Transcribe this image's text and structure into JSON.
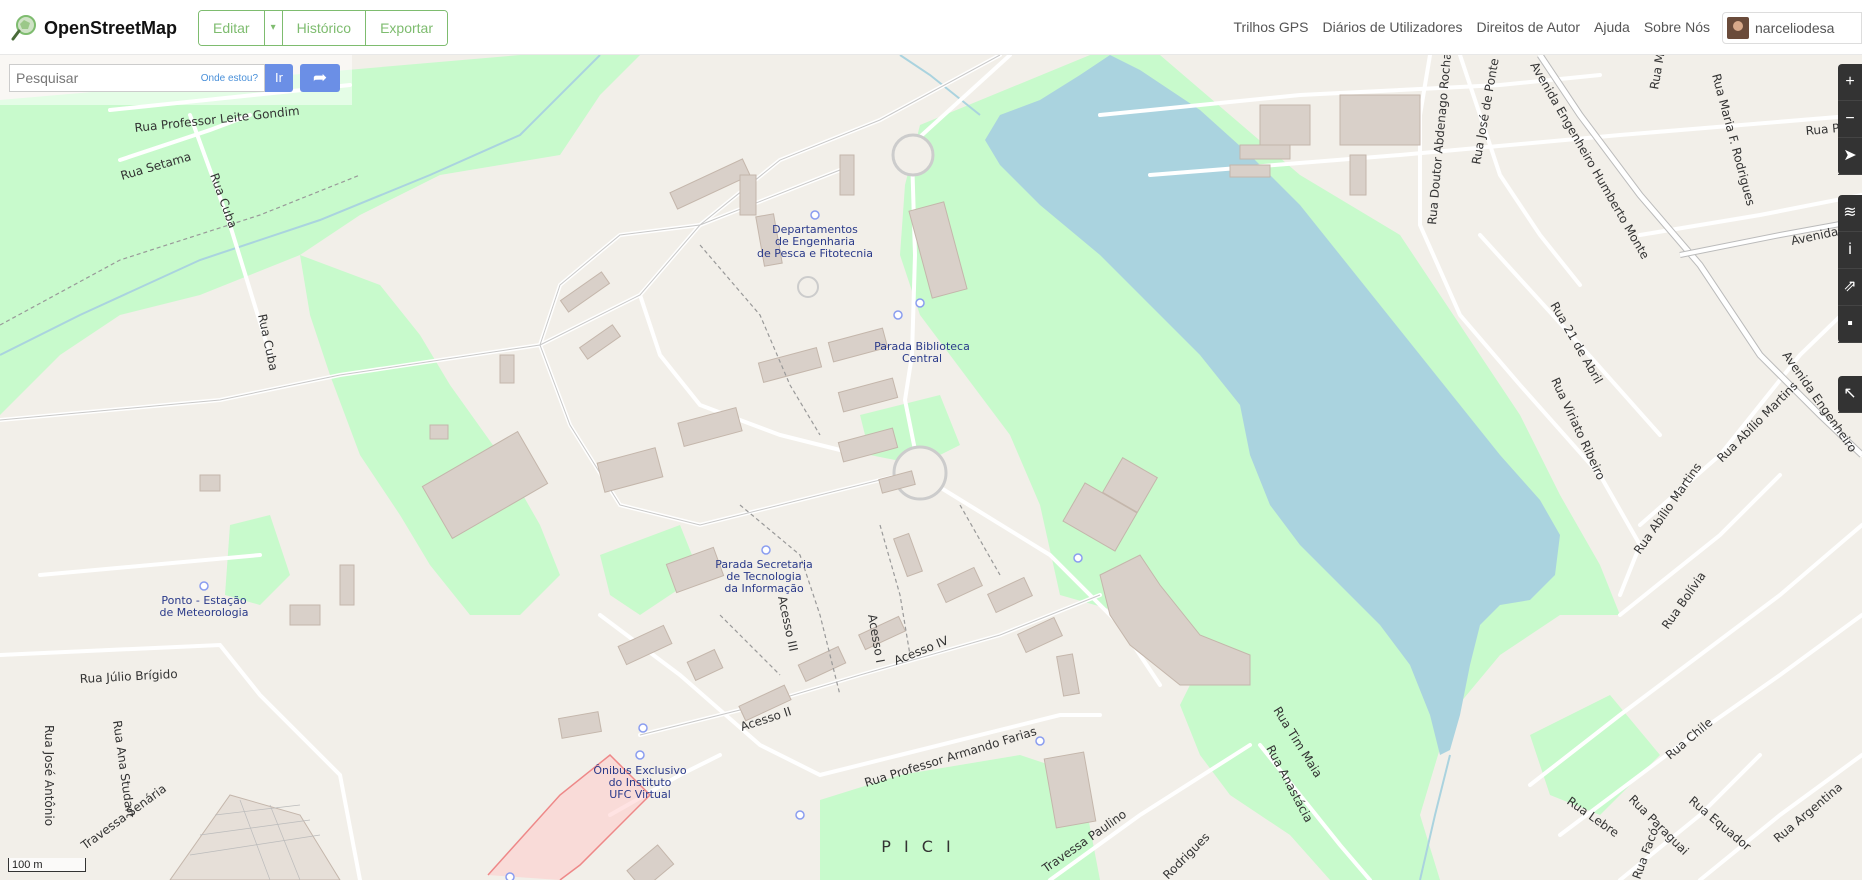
{
  "header": {
    "brand": "OpenStreetMap",
    "edit_label": "Editar",
    "history_label": "Histórico",
    "export_label": "Exportar",
    "nav": [
      "Trilhos GPS",
      "Diários de Utilizadores",
      "Direitos de Autor",
      "Ajuda",
      "Sobre Nós"
    ],
    "username": "narceliodesa"
  },
  "search": {
    "placeholder": "Pesquisar",
    "where_am_i": "Onde estou?",
    "go_label": "Ir"
  },
  "controls": {
    "icons": [
      "zoom-in-icon",
      "zoom-out-icon",
      "locate-icon",
      "layers-icon",
      "info-icon",
      "share-icon",
      "note-icon",
      "query-icon"
    ]
  },
  "scale": {
    "label": "100 m"
  },
  "colors": {
    "brand_green": "#7ebc6f",
    "button_blue": "#6b8fe6",
    "water": "#aad3df",
    "park": "#c8facc",
    "land": "#f2efe9"
  },
  "map_labels": {
    "lake": "",
    "dept": [
      "Departamentos",
      "de Engenharia",
      "de Pesca e Fitotecnia"
    ],
    "parada_biblioteca": [
      "Parada Biblioteca",
      "Central"
    ],
    "parada_secretaria": [
      "Parada Secretaria",
      "de Tecnologia",
      "da Informação"
    ],
    "ponto_estacao": [
      "Ponto - Estação",
      "de Meteorologia"
    ],
    "onibus": [
      "Ônibus Exclusivo",
      "do Instituto",
      "UFC Virtual"
    ],
    "district": "P I C I"
  },
  "streets": {
    "leite_gondim": "Rua Professor Leite Gondim",
    "setama": "Rua Setama",
    "cuba_1": "Rua Cuba",
    "cuba_2": "Rua Cuba",
    "julio_brigido": "Rua Júlio Brígido",
    "jose_antonio": "Rua José Antônio",
    "ana_studart": "Rua Ana Studart",
    "travessa_senaria": "Travessa Senária",
    "acesso_ii": "Acesso II",
    "acesso_iii": "Acesso III",
    "acesso_iv": "Acesso IV",
    "acesso_i": "Acesso I",
    "armando_farias": "Rua Professor Armando Farias",
    "travessa_paulino": "Travessa Paulino",
    "tim_maia": "Rua Tim Maia",
    "anastacia": "Rua Anastácia",
    "rodrigues": "Rodrigues",
    "doutor_abdenago": "Rua Doutor Abdenago Rocha",
    "jose_ponte": "Rua José de Ponte",
    "avenida_humberto": "Avenida Engenheiro Humberto Monte",
    "maria_rodrigues": "Rua Maria F. Rodrigues",
    "rua_21_abril": "Rua 21 de Abril",
    "viriato": "Rua Viriato Ribeiro",
    "abilio_1": "Rua Abílio Martins",
    "abilio_2": "Rua Abílio Martins",
    "bolivia": "Rua Bolívia",
    "chile": "Rua Chile",
    "equador": "Rua Equador",
    "argentina": "Rua Argentina",
    "paraguai": "Rua Paraguai",
    "lebre": "Rua Lebre",
    "avenida_eng": "Avenida Engenheiro",
    "rua_m": "Rua M",
    "rua_pa": "Rua Pa",
    "avenida_jovi": "Avenida Jovi",
    "faco": "Rua Facó"
  }
}
